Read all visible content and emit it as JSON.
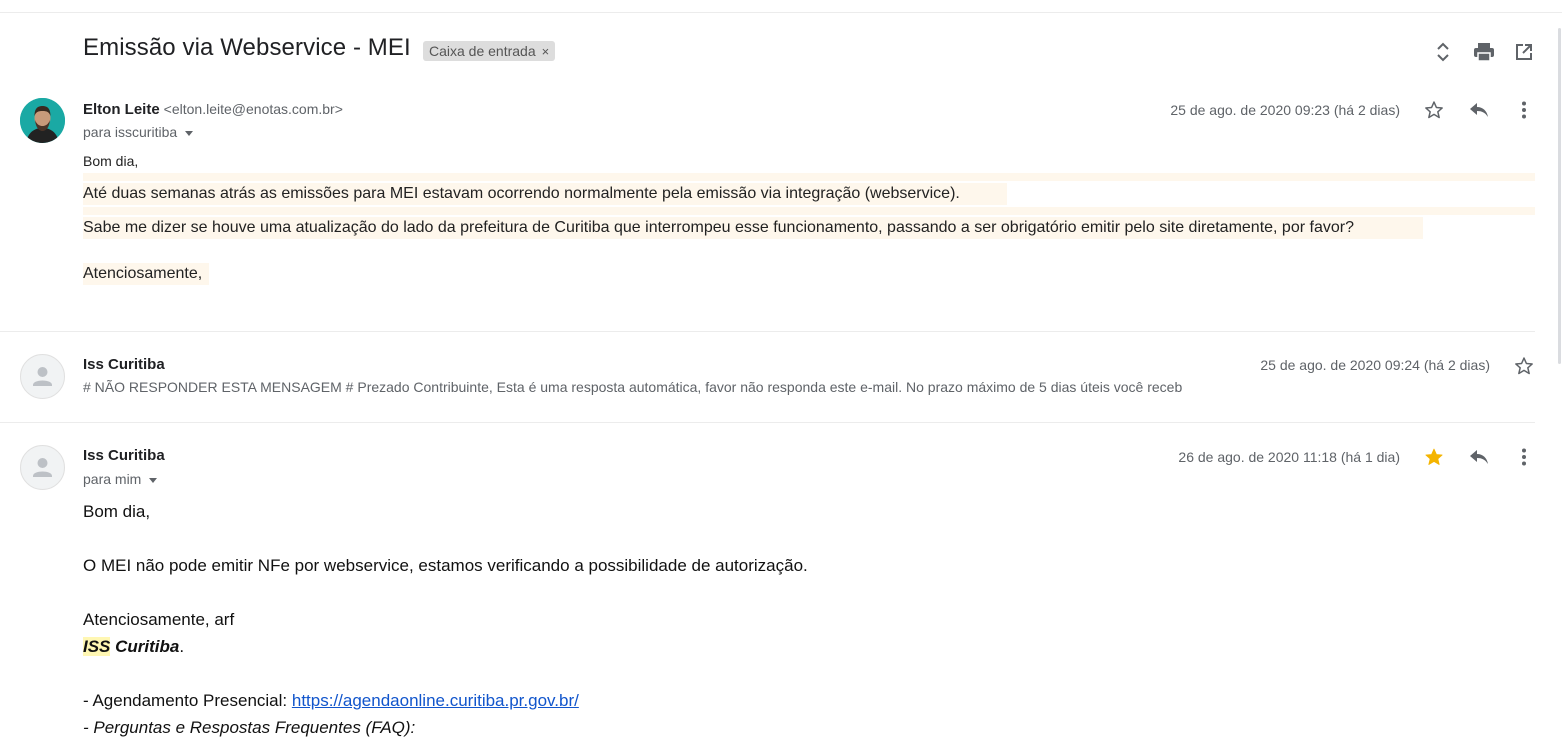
{
  "thread": {
    "subject": "Emissão via Webservice - MEI",
    "label": "Caixa de entrada",
    "label_close": "×",
    "actions": [
      "expand-all-icon",
      "print-icon",
      "open-in-new-window-icon"
    ]
  },
  "messages": [
    {
      "sender_name": "Elton Leite",
      "sender_email": "<elton.leite@enotas.com.br>",
      "recipients": "para isscuritiba",
      "date": "25 de ago. de 2020 09:23 (há 2 dias)",
      "starred": false,
      "body": {
        "greeting": "Bom dia,",
        "line1": "Até duas semanas atrás as emissões para MEI estavam ocorrendo normalmente pela emissão via integração (webservice).",
        "line2": "Sabe me dizer se houve uma atualização do lado da prefeitura de Curitiba que interrompeu esse funcionamento, passando a ser obrigatório emitir pelo site diretamente, por favor?",
        "signoff": "Atenciosamente,"
      }
    },
    {
      "sender_name": "Iss Curitiba",
      "date": "25 de ago. de 2020 09:24 (há 2 dias)",
      "starred": false,
      "snippet": "# NÃO RESPONDER ESTA MENSAGEM # Prezado Contribuinte, Esta é uma resposta automática, favor não responda este e-mail. No prazo máximo de 5 dias úteis você receb"
    },
    {
      "sender_name": "Iss Curitiba",
      "recipients": "para mim",
      "date": "26 de ago. de 2020 11:18 (há 1 dia)",
      "starred": true,
      "body": {
        "greeting": "Bom dia,",
        "line1": "O MEI não pode emitir NFe por webservice, estamos verificando a possibilidade de autorização.",
        "signoff": "Atenciosamente, arf",
        "sig_iss": "ISS",
        "sig_city": "Curitiba",
        "sig_dot": ".",
        "sched_label": "- Agendamento Presencial: ",
        "sched_link": "https://agendaonline.curitiba.pr.gov.br/",
        "faq": "- Perguntas e Respostas Frequentes (FAQ):"
      }
    }
  ],
  "colors": {
    "star_active": "#f4b400",
    "highlight": "#fef7ec",
    "link": "#1155cc"
  }
}
